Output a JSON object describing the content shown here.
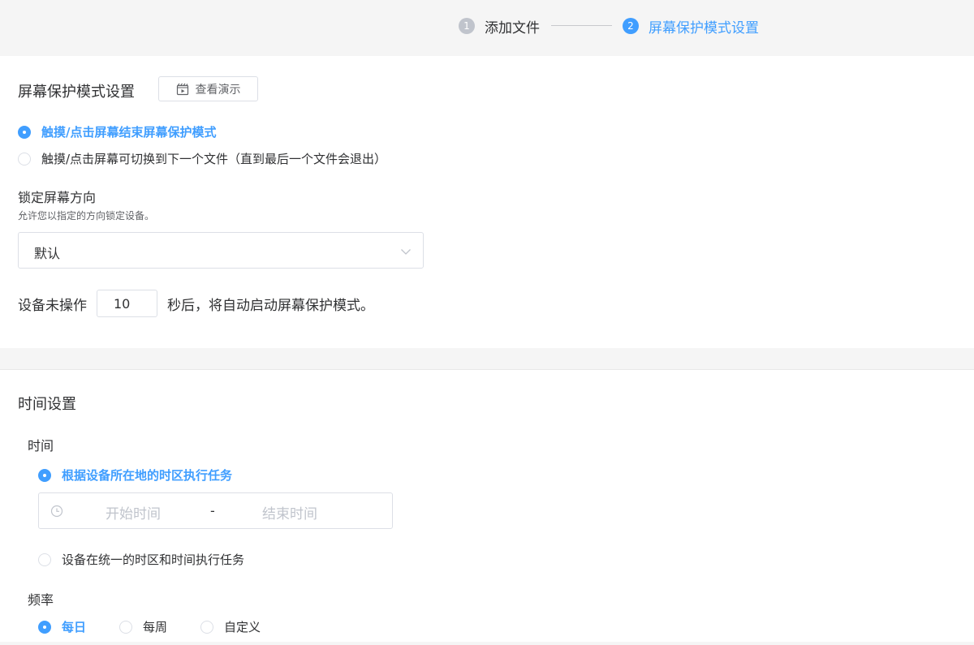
{
  "steps": [
    {
      "num": "1",
      "label": "添加文件",
      "state": "done"
    },
    {
      "num": "2",
      "label": "屏幕保护模式设置",
      "state": "active"
    }
  ],
  "screensaver": {
    "title": "屏幕保护模式设置",
    "demo_button": {
      "label": "查看演示",
      "icon": "video-icon"
    },
    "exit_options": [
      {
        "label": "触摸/点击屏幕结束屏幕保护模式",
        "checked": true
      },
      {
        "label": "触摸/点击屏幕可切换到下一个文件（直到最后一个文件会退出）",
        "checked": false
      }
    ],
    "orientation": {
      "title": "锁定屏幕方向",
      "hint": "允许您以指定的方向锁定设备。",
      "selected": "默认"
    },
    "idle": {
      "prefix": "设备未操作",
      "seconds": "10",
      "suffix": "秒后，将自动启动屏幕保护模式。"
    }
  },
  "time_settings": {
    "title": "时间设置",
    "time_label": "时间",
    "timezone_options": [
      {
        "label": "根据设备所在地的时区执行任务",
        "checked": true
      },
      {
        "label": "设备在统一的时区和时间执行任务",
        "checked": false
      }
    ],
    "range": {
      "start_placeholder": "开始时间",
      "separator": "-",
      "end_placeholder": "结束时间",
      "icon": "clock-icon"
    },
    "frequency_label": "频率",
    "frequency_options": [
      {
        "label": "每日",
        "checked": true
      },
      {
        "label": "每周",
        "checked": false
      },
      {
        "label": "自定义",
        "checked": false
      }
    ]
  },
  "colors": {
    "accent": "#409eff",
    "text": "#303133",
    "muted": "#c0c4cc",
    "border": "#dcdfe6",
    "background": "#f5f5f5"
  }
}
